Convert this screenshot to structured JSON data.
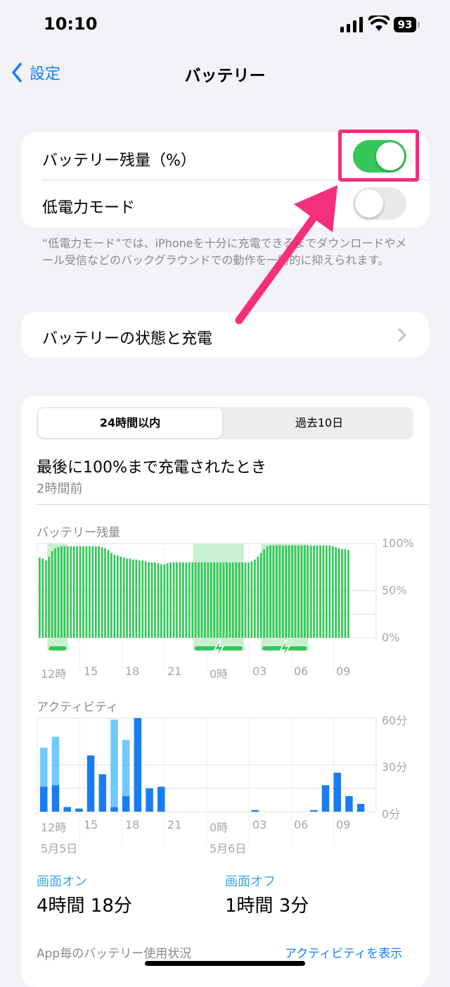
{
  "status_bar": {
    "time": "10:10",
    "battery_level": "93"
  },
  "nav": {
    "back_label": "設定",
    "title": "バッテリー"
  },
  "settings": {
    "battery_percentage": {
      "label": "バッテリー残量（%）",
      "on": true
    },
    "low_power_mode": {
      "label": "低電力モード",
      "on": false
    },
    "footnote": "“低電力モード”では、iPhoneを十分に充電できるまでダウンロードやメール受信などのバックグラウンドでの動作を一時的に抑えられます。",
    "health_row": "バッテリーの状態と充電"
  },
  "usage": {
    "tabs": [
      "24時間以内",
      "過去10日"
    ],
    "selected_tab": "24時間以内",
    "last_charged_title": "最後に100%まで充電されたとき",
    "last_charged_time": "2時間前",
    "screen_on_label": "画面オン",
    "screen_on_value": "4時間 18分",
    "screen_off_label": "画面オフ",
    "screen_off_value": "1時間 3分",
    "per_app_label": "App毎のバッテリー使用状況",
    "show_activity": "アクティビティを表示"
  },
  "colors": {
    "accent": "#147efb",
    "green": "#34c759",
    "annotation": "#f52f7b",
    "activity_dark": "#1a7cf2",
    "activity_light": "#6fcbfb"
  },
  "chart_data": [
    {
      "type": "bar",
      "title": "バッテリー残量",
      "x_tick_labels": [
        "12時",
        "15",
        "18",
        "21",
        "0時",
        "03",
        "06",
        "09"
      ],
      "y_tick_labels": [
        "100%",
        "50%",
        "0%"
      ],
      "ylim": [
        0,
        100
      ],
      "values": [
        85,
        84,
        82,
        86,
        92,
        95,
        96,
        97,
        97,
        97,
        97,
        97,
        97,
        97,
        97,
        97,
        97,
        97,
        97,
        97,
        96,
        95,
        93,
        90,
        88,
        87,
        86,
        85,
        84,
        84,
        83,
        83,
        82,
        82,
        81,
        80,
        80,
        80,
        79,
        78,
        78,
        79,
        80,
        80,
        80,
        80,
        80,
        80,
        80,
        80,
        80,
        80,
        80,
        80,
        80,
        80,
        80,
        80,
        80,
        80,
        80,
        80,
        80,
        80,
        80,
        80,
        80,
        80,
        81,
        83,
        86,
        90,
        94,
        97,
        98,
        98,
        98,
        98,
        98,
        98,
        98,
        98,
        98,
        98,
        98,
        98,
        98,
        98,
        98,
        98,
        98,
        98,
        98,
        98,
        97,
        96,
        95,
        94,
        94,
        93
      ],
      "charging_periods": [
        [
          0.03,
          0.09
        ],
        [
          0.46,
          0.61
        ],
        [
          0.66,
          0.8
        ]
      ]
    },
    {
      "type": "bar",
      "title": "アクティビティ",
      "x_tick_labels": [
        "12時",
        "15",
        "18",
        "21",
        "0時",
        "03",
        "06",
        "09"
      ],
      "date_labels": [
        "5月5日",
        "5月6日"
      ],
      "y_tick_labels": [
        "60分",
        "30分",
        "0分"
      ],
      "ylim": [
        0,
        60
      ],
      "series": [
        {
          "name": "画面オン",
          "values": [
            16,
            17,
            3,
            2,
            36,
            24,
            3,
            10,
            60,
            15,
            16,
            0,
            0,
            0,
            0,
            0,
            0,
            0,
            1,
            0,
            0,
            0,
            0,
            1,
            17,
            25,
            10,
            5
          ]
        },
        {
          "name": "画面オフ",
          "values": [
            25,
            31,
            0,
            0,
            0,
            0,
            56,
            36,
            0,
            0,
            0,
            0,
            0,
            0,
            0,
            0,
            0,
            0,
            0,
            0,
            0,
            0,
            0,
            0,
            0,
            0,
            0,
            0
          ]
        }
      ]
    }
  ]
}
